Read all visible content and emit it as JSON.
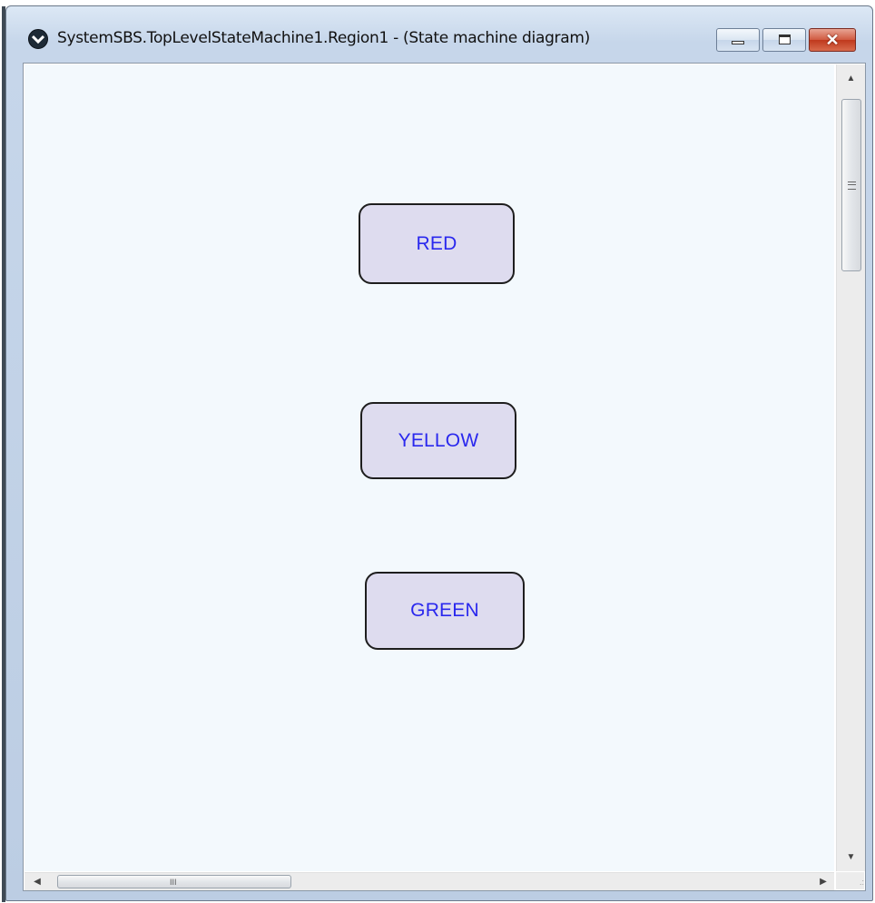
{
  "window": {
    "title": "SystemSBS.TopLevelStateMachine1.Region1 - (State machine diagram)",
    "app_icon": "chevron-down-circle-icon",
    "controls": {
      "minimize_icon": "minimize-icon",
      "maximize_icon": "maximize-icon",
      "close_icon": "close-icon",
      "close_glyph": "✕"
    }
  },
  "diagram": {
    "states": [
      {
        "label": "RED"
      },
      {
        "label": "YELLOW"
      },
      {
        "label": "GREEN"
      }
    ],
    "colors": {
      "canvas_background": "#f3f9fd",
      "state_fill": "#dedcef",
      "state_border": "#1e1e1e",
      "state_text": "#2a28ee"
    }
  },
  "scrollbars": {
    "vertical": {
      "up_glyph": "▲",
      "down_glyph": "▼",
      "grip_icon": "grip-lines-icon"
    },
    "horizontal": {
      "left_glyph": "◀",
      "right_glyph": "▶",
      "grip_text": "III"
    },
    "size_grip_icon": "resize-grip-icon"
  }
}
